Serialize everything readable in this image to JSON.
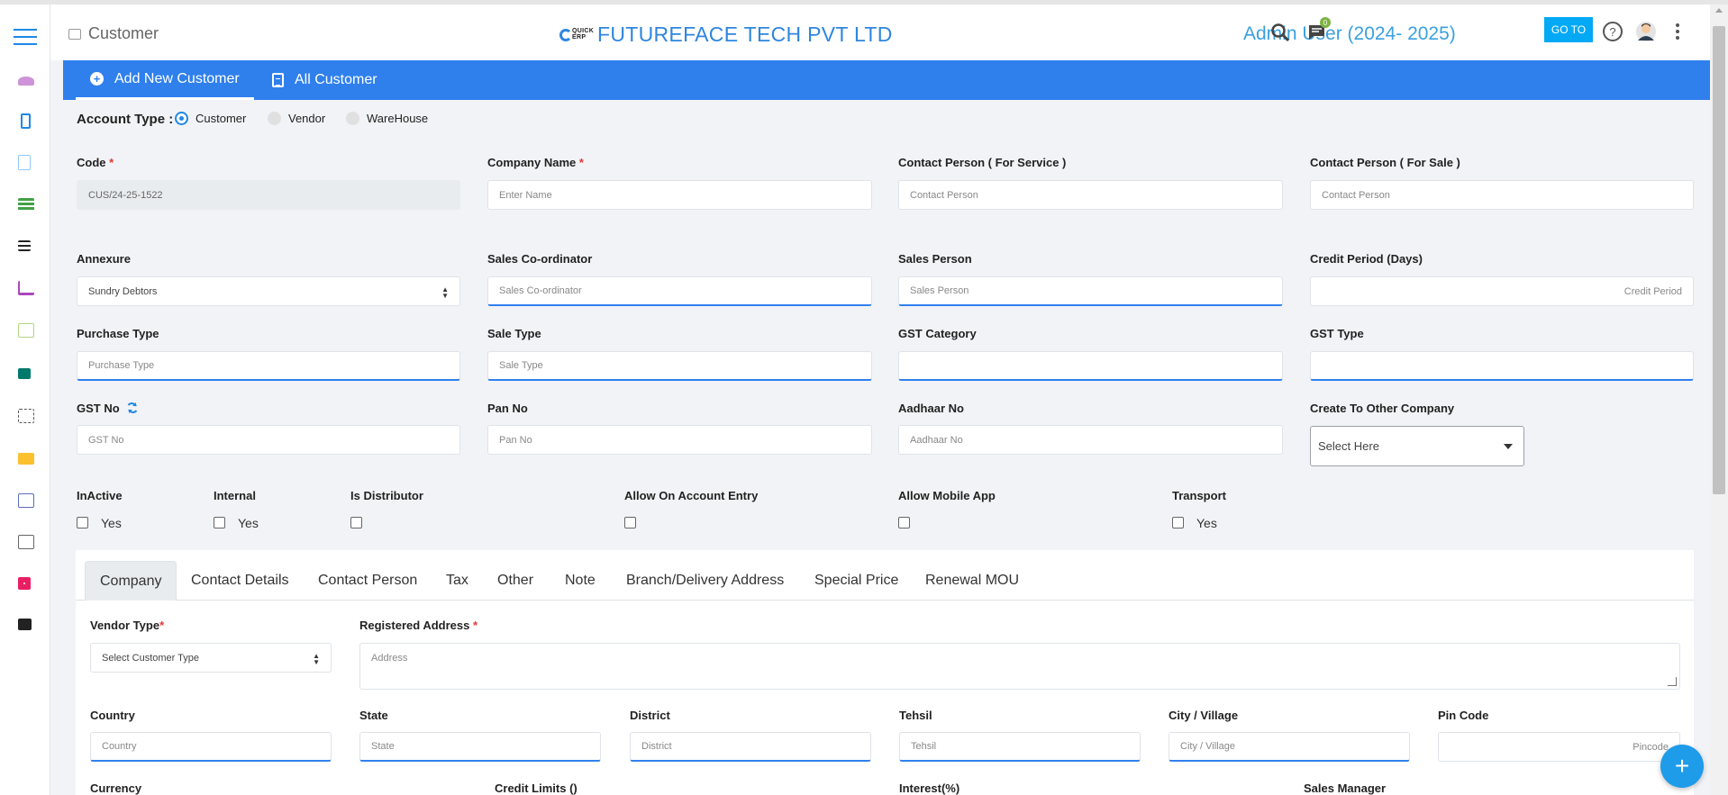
{
  "header": {
    "page_title": "Customer",
    "company": "FUTUREFACE TECH PVT LTD",
    "logo_text": "QUICK ERP",
    "user": "Admin User (2024- 2025)",
    "notification_count": "0",
    "goto_label": "GO TO"
  },
  "tabs": {
    "add_new": "Add New Customer",
    "all": "All Customer"
  },
  "account_type": {
    "label": "Account Type :",
    "options": [
      "Customer",
      "Vendor",
      "WareHouse"
    ],
    "selected": "Customer"
  },
  "form": {
    "code_label": "Code",
    "code_value": "CUS/24-25-1522",
    "company_name_label": "Company Name",
    "company_name_ph": "Enter Name",
    "contact_service_label": "Contact Person ( For Service )",
    "contact_service_ph": "Contact Person",
    "contact_sale_label": "Contact Person ( For Sale )",
    "contact_sale_ph": "Contact Person",
    "annexure_label": "Annexure",
    "annexure_value": "Sundry Debtors",
    "sales_coord_label": "Sales Co-ordinator",
    "sales_coord_ph": "Sales Co-ordinator",
    "sales_person_label": "Sales Person",
    "sales_person_ph": "Sales Person",
    "credit_period_label": "Credit Period (Days)",
    "credit_period_ph": "Credit Period",
    "purchase_type_label": "Purchase Type",
    "purchase_type_ph": "Purchase Type",
    "sale_type_label": "Sale Type",
    "sale_type_ph": "Sale Type",
    "gst_category_label": "GST Category",
    "gst_type_label": "GST Type",
    "gst_no_label": "GST No",
    "gst_no_ph": "GST No",
    "pan_label": "Pan No",
    "pan_ph": "Pan No",
    "aadhaar_label": "Aadhaar No",
    "aadhaar_ph": "Aadhaar No",
    "other_company_label": "Create To Other Company",
    "other_company_value": "Select Here"
  },
  "flags": {
    "inactive_label": "InActive",
    "internal_label": "Internal",
    "distributor_label": "Is Distributor",
    "account_entry_label": "Allow On Account Entry",
    "mobile_app_label": "Allow Mobile App",
    "transport_label": "Transport",
    "yes": "Yes"
  },
  "subtabs": [
    "Company",
    "Contact Details",
    "Contact Person",
    "Tax",
    "Other",
    "Note",
    "Branch/Delivery Address",
    "Special Price",
    "Renewal MOU"
  ],
  "company_tab": {
    "vendor_type_label": "Vendor Type",
    "vendor_type_value": "Select Customer Type",
    "address_label": "Registered Address",
    "address_ph": "Address",
    "country_label": "Country",
    "country_ph": "Country",
    "state_label": "State",
    "state_ph": "State",
    "district_label": "District",
    "district_ph": "District",
    "tehsil_label": "Tehsil",
    "tehsil_ph": "Tehsil",
    "city_label": "City / Village",
    "city_ph": "City / Village",
    "pin_label": "Pin Code",
    "pin_ph": "Pincode",
    "currency_label": "Currency",
    "credit_limits_label": "Credit Limits ()",
    "interest_label": "Interest(%)",
    "sales_manager_label": "Sales Manager"
  },
  "colors": {
    "primary": "#2f80ed",
    "accent": "#03a9f4",
    "required": "#e53935"
  },
  "icons": [
    "menu-icon",
    "search-icon",
    "chat-icon",
    "help-icon",
    "avatar",
    "more-icon",
    "refresh-icon",
    "plus-icon"
  ]
}
